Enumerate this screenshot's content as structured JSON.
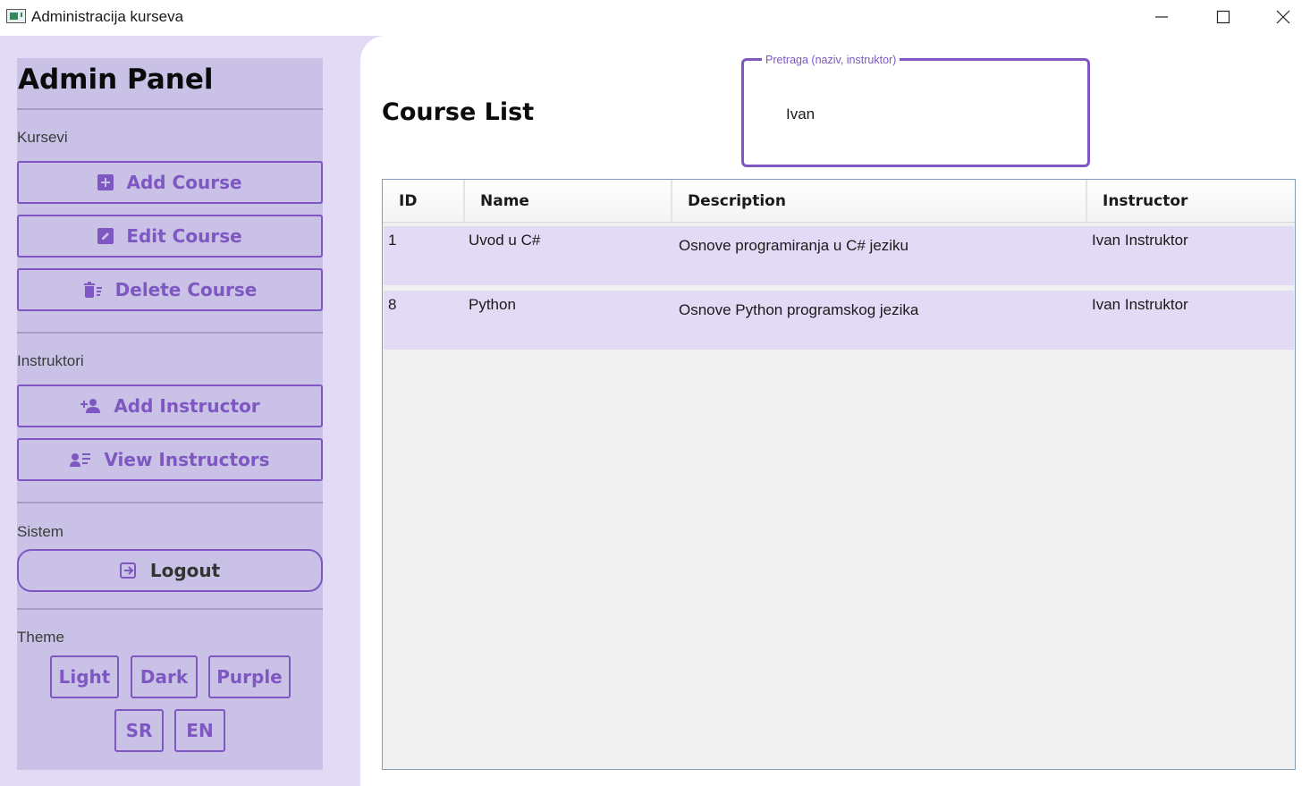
{
  "window": {
    "title": "Administracija kurseva"
  },
  "sidebar": {
    "brand": "Admin Panel",
    "sections": {
      "courses": "Kursevi",
      "instructors": "Instruktori",
      "system": "Sistem",
      "theme": "Theme"
    },
    "buttons": {
      "add_course": "Add Course",
      "edit_course": "Edit Course",
      "delete_course": "Delete Course",
      "add_instructor": "Add Instructor",
      "view_instructors": "View Instructors",
      "logout": "Logout"
    },
    "theme_buttons": {
      "light": "Light",
      "dark": "Dark",
      "purple": "Purple",
      "sr": "SR",
      "en": "EN"
    }
  },
  "main": {
    "title": "Course List",
    "search": {
      "legend": "Pretraga (naziv, instruktor)",
      "value": "Ivan"
    },
    "table": {
      "columns": [
        "ID",
        "Name",
        "Description",
        "Instructor"
      ],
      "rows": [
        [
          "1",
          "Uvod u C#",
          "Osnove programiranja u C# jeziku",
          "Ivan Instruktor"
        ],
        [
          "8",
          "Python",
          "Osnove Python programskog jezika",
          "Ivan Instruktor"
        ]
      ]
    }
  },
  "colors": {
    "accent": "#7e57c2",
    "sidebar_bg": "#c9c2e6",
    "window_bg": "#e3daf5",
    "row_bg": "#e3daf5"
  }
}
